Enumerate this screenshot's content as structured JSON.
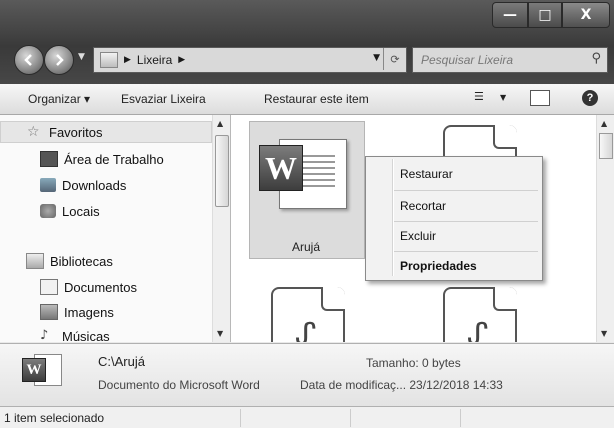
{
  "window": {
    "minimize_glyph": "—",
    "maximize_glyph": "□",
    "close_glyph": "X"
  },
  "address_bar": {
    "separator_glyph": "▶",
    "location": "Lixeira",
    "dropdown_glyph": "▼",
    "refresh_glyph": "⟳"
  },
  "search": {
    "placeholder": "Pesquisar Lixeira",
    "icon": "search-icon",
    "icon_glyph": "⚲"
  },
  "toolbar": {
    "organize": "Organizar ▾",
    "empty": "Esvaziar Lixeira",
    "restore": "Restaurar este item",
    "views_glyph": "☰",
    "views_dropdown_glyph": "▼",
    "help_glyph": "?"
  },
  "nav": {
    "favorites": "Favoritos",
    "desktop": "Área de Trabalho",
    "downloads": "Downloads",
    "locals": "Locais",
    "libraries": "Bibliotecas",
    "documents": "Documentos",
    "images": "Imagens",
    "music": "Músicas"
  },
  "files": {
    "selected_name": "Arujá",
    "word_badge": "W",
    "pdf_glyph": "ᔑ"
  },
  "context_menu": {
    "restore": "Restaurar",
    "cut": "Recortar",
    "delete": "Excluir",
    "properties": "Propriedades"
  },
  "details": {
    "name": "C:\\Arujá",
    "type": "Documento do Microsoft Word",
    "size_label": "Tamanho: 0 bytes",
    "modified_label": "Data de modificaç... 23/12/2018 14:33",
    "icon_badge": "W"
  },
  "status": {
    "text": "1 item selecionado"
  },
  "scrollbars": {
    "up_glyph": "▲",
    "down_glyph": "▼"
  }
}
